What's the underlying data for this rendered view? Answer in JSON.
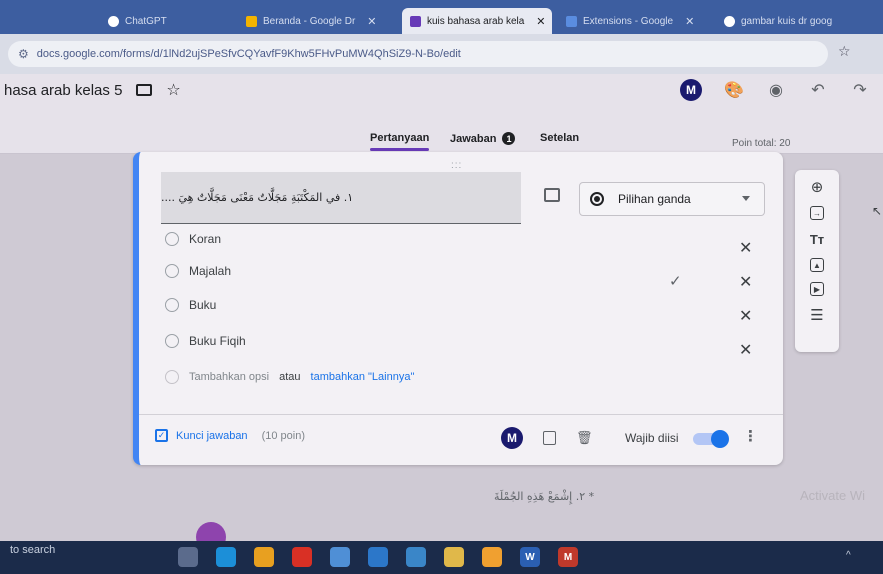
{
  "browser": {
    "tabs": [
      {
        "label": "ChatGPT",
        "active": false
      },
      {
        "label": "Beranda - Google Dr",
        "active": false
      },
      {
        "label": "kuis bahasa arab kela",
        "active": true
      },
      {
        "label": "Extensions - Google",
        "active": false
      },
      {
        "label": "gambar kuis dr goog",
        "active": false
      }
    ],
    "url": "docs.google.com/forms/d/1lNd2ujSPeSfvCQYavfF9Khw5FHvPuMW4QhSiZ9-N-Bo/edit"
  },
  "form": {
    "title": "hasa arab kelas 5",
    "nav_tabs": [
      {
        "label": "Pertanyaan",
        "active": true
      },
      {
        "label": "Jawaban",
        "badge": "1"
      },
      {
        "label": "Setelan"
      }
    ],
    "points_total": "Poin total: 20"
  },
  "question": {
    "handle": ":::",
    "text": "١. في المَكْتَبَةِ مَجَلَّاتٌ مَعْنَى مَجَلَّاتٌ هِيَ ....",
    "type": "Pilihan ganda",
    "options": [
      "Koran",
      "Majalah",
      "Buku",
      "Buku Fiqih"
    ],
    "add_option": "Tambahkan opsi",
    "add_or": "atau",
    "add_other": "tambahkan \"Lainnya\"",
    "answer_key": "Kunci jawaban",
    "answer_points": "(10 poin)",
    "required_label": "Wajib diisi"
  },
  "next_question": "* ٢. إِشْمَعْ هَذِهِ الجُمْلَةَ",
  "watermark": "Activate Wi",
  "taskbar": {
    "search": "to search",
    "apps": [
      {
        "name": "task-view",
        "color": "#5b6b8c"
      },
      {
        "name": "edge",
        "color": "#1c8fd8"
      },
      {
        "name": "paint",
        "color": "#e8a020"
      },
      {
        "name": "opera",
        "color": "#d93025"
      },
      {
        "name": "files",
        "color": "#4f8fd6"
      },
      {
        "name": "mail",
        "color": "#2c77c9"
      },
      {
        "name": "calendar",
        "color": "#3a86c8"
      },
      {
        "name": "explorer",
        "color": "#e0b84a"
      },
      {
        "name": "chrome",
        "color": "#f0a030"
      },
      {
        "name": "word",
        "label": "W",
        "color": "#2b5fb3"
      },
      {
        "name": "app-m",
        "label": "M",
        "color": "#c0392b"
      }
    ]
  }
}
